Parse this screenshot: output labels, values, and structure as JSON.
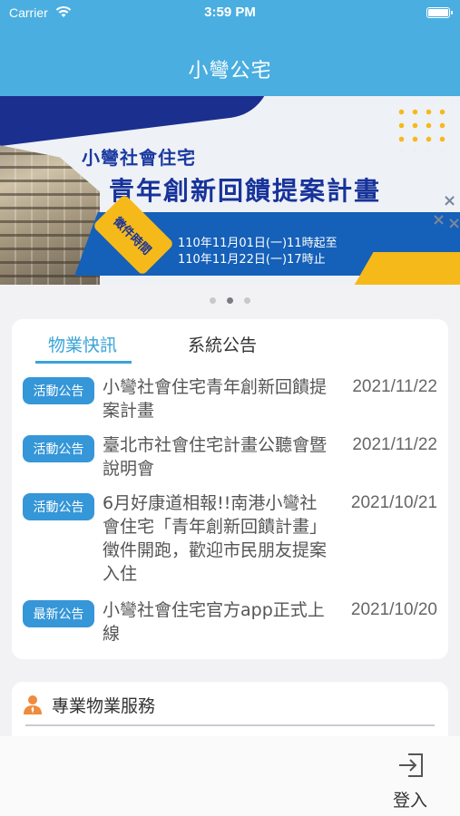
{
  "status_bar": {
    "carrier": "Carrier",
    "time": "3:59 PM"
  },
  "nav": {
    "title": "小彎公宅"
  },
  "banner": {
    "subtitle": "小彎社會住宅",
    "title": "青年創新回饋提案計畫",
    "badge": "徵件時間",
    "date_start": "110年11月01日(一)11時起至",
    "date_end": "110年11月22日(一)17時止",
    "page_index": 2,
    "page_count": 3
  },
  "tabs": [
    {
      "label": "物業快訊",
      "active": true
    },
    {
      "label": "系統公告",
      "active": false
    }
  ],
  "news": [
    {
      "badge": "活動公告",
      "title": "小彎社會住宅青年創新回饋提案計畫",
      "date": "2021/11/22"
    },
    {
      "badge": "活動公告",
      "title": "臺北市社會住宅計畫公聽會暨說明會",
      "date": "2021/11/22"
    },
    {
      "badge": "活動公告",
      "title": "6月好康道相報!!南港小彎社會住宅「青年創新回饋計畫」徵件開跑，歡迎市民朋友提案入住",
      "date": "2021/10/21"
    },
    {
      "badge": "最新公告",
      "title": "小彎社會住宅官方app正式上線",
      "date": "2021/10/20"
    }
  ],
  "services": {
    "title": "專業物業服務",
    "icon": "person-icon"
  },
  "bottom": {
    "login_label": "登入",
    "login_icon": "login-icon"
  },
  "colors": {
    "header": "#4aaee0",
    "accent": "#3aa3d8",
    "badge": "#3596d8",
    "banner_yellow": "#f6b91a",
    "banner_navy": "#17339a"
  }
}
